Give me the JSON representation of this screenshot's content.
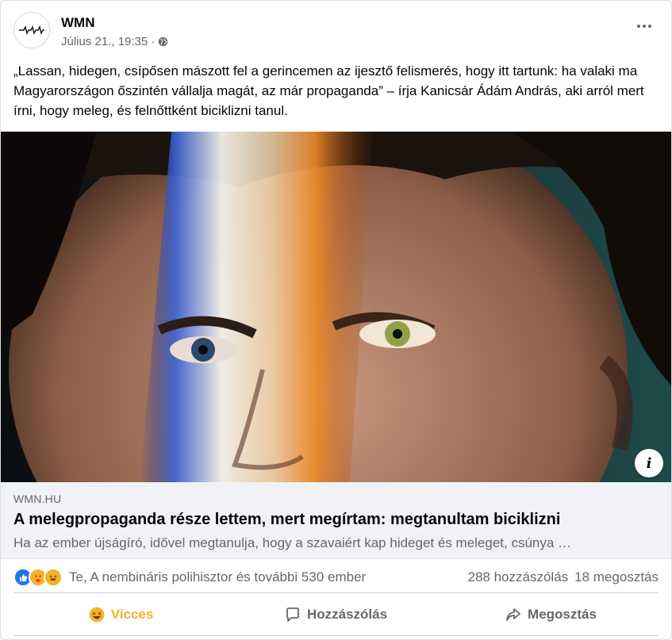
{
  "post": {
    "page_name": "WMN",
    "timestamp": "Július 21., 19:35 ·",
    "audience_icon": "globe-icon",
    "text": "„Lassan, hidegen, csípősen mászott fel a gerincemen az ijesztő felismerés, hogy itt tartunk: ha valaki ma Magyarországon őszintén vállalja magát, az már propaganda” – írja Kanicsár Ádám András, aki arról mert írni, hogy meleg, és felnőttként biciklizni tanul."
  },
  "link_preview": {
    "domain": "WMN.HU",
    "title": "A melegpropaganda része lettem, mert megírtam: megtanultam biciklizni",
    "description": "Ha az ember újságíró, idővel megtanulja, hogy a szavaiért kap hideget és meleget, csúnya …"
  },
  "stats": {
    "reaction_icons": [
      "like-icon",
      "care-icon",
      "haha-icon"
    ],
    "reactors": "Te, A nembináris polihisztor és további 530 ember",
    "comments": "288 hozzászólás",
    "shares": "18 megosztás"
  },
  "actions": {
    "react_label": "Vicces",
    "comment_label": "Hozzászólás",
    "share_label": "Megosztás"
  },
  "colors": {
    "like_blue": "#1877f2",
    "haha_yellow": "#f7b125",
    "secondary_text": "#65676b"
  }
}
